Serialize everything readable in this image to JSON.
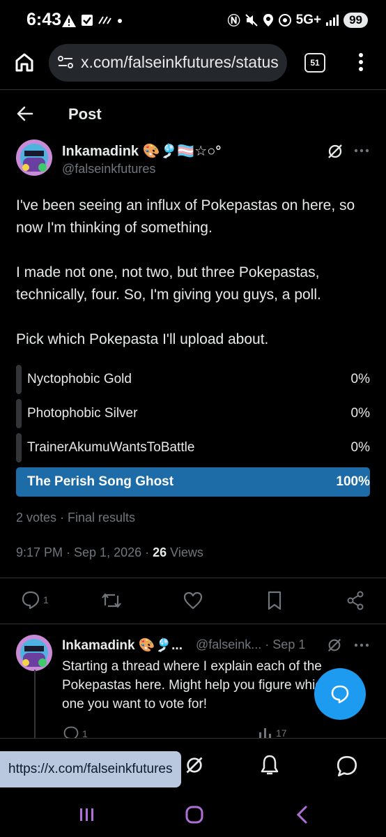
{
  "status_bar": {
    "time": "6:43",
    "network": "5G+",
    "battery": "99"
  },
  "browser": {
    "url": "x.com/falseinkfutures/status",
    "tab_count": "51"
  },
  "header": {
    "title": "Post"
  },
  "post": {
    "author_name": "Inkamadink 🎨🎐🏳️‍⚧️☆○°",
    "author_handle": "@falseinkfutures",
    "text": [
      "I've been seeing an influx of Pokepastas on here, so now I'm thinking of something.",
      "I made not one, not two, but three Pokepastas, technically, four. So, I'm giving you guys, a poll.",
      "Pick which Pokepasta I'll upload about."
    ],
    "poll": {
      "options": [
        {
          "label": "Nyctophobic Gold",
          "percent": "0%",
          "share": 0
        },
        {
          "label": "Photophobic Silver",
          "percent": "0%",
          "share": 0
        },
        {
          "label": "TrainerAkumuWantsToBattle",
          "percent": "0%",
          "share": 0
        },
        {
          "label": "The Perish Song Ghost",
          "percent": "100%",
          "share": 1
        }
      ],
      "summary": "2 votes · Final results"
    },
    "timestamp": "9:17 PM · Sep 1, 2026 · ",
    "views_count": "26",
    "views_label": " Views",
    "reply_count": "1"
  },
  "reply": {
    "author_name": "Inkamadink 🎨🎐...",
    "handle_date": "@falseink... · Sep 1",
    "text": "Starting a thread where I explain each of the Pokepastas here. Might help you figure which one you want to vote for!",
    "reply_count": "1",
    "views_count": "17"
  },
  "tooltip": {
    "url": "https://x.com/falseinkfutures"
  },
  "colors": {
    "accent": "#1d9bf0",
    "poll_winner": "#1d6ca8",
    "background": "#000000"
  }
}
